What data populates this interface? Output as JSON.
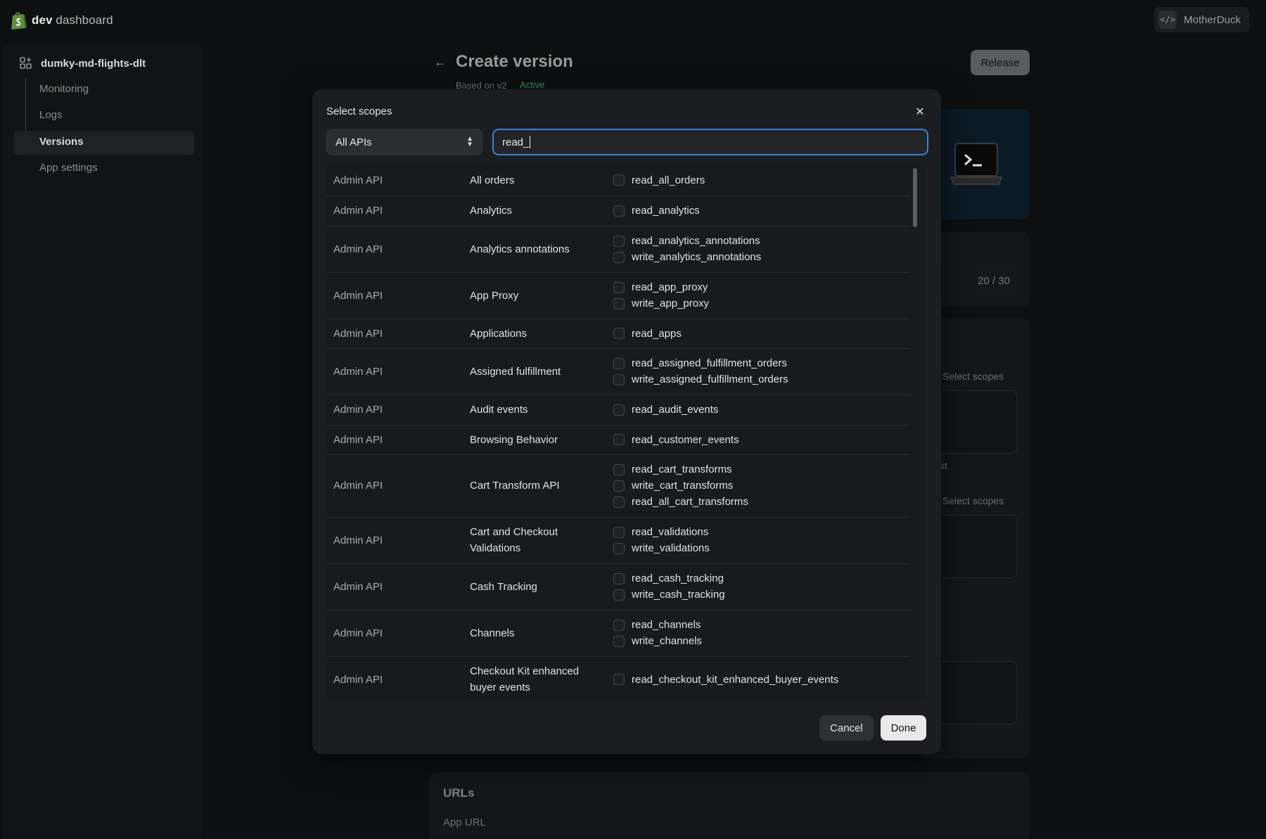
{
  "topbar": {
    "brand_bold": "dev",
    "brand_rest": " dashboard",
    "org_name": "MotherDuck",
    "org_icon": "code-icon"
  },
  "sidebar": {
    "app_name": "dumky-md-flights-dlt",
    "items": [
      {
        "label": "Monitoring"
      },
      {
        "label": "Logs"
      },
      {
        "label": "Versions"
      },
      {
        "label": "App settings"
      }
    ]
  },
  "page": {
    "title": "Create version",
    "subtitle": "Based on v2",
    "badge": "Active",
    "release_label": "Release",
    "counter": "20 / 30",
    "select_scopes_link": "Select scopes",
    "ghost_text": "st",
    "urls_title": "URLs",
    "app_url_label": "App URL"
  },
  "modal": {
    "title": "Select scopes",
    "filter_value": "All APIs",
    "search_value": "read_",
    "cancel_label": "Cancel",
    "done_label": "Done",
    "rows": [
      {
        "api": "Admin API",
        "resource": [
          "All orders"
        ],
        "scopes": [
          "read_all_orders"
        ]
      },
      {
        "api": "Admin API",
        "resource": [
          "Analytics"
        ],
        "scopes": [
          "read_analytics"
        ]
      },
      {
        "api": "Admin API",
        "resource": [
          "Analytics annotations"
        ],
        "scopes": [
          "read_analytics_annotations",
          "write_analytics_annotations"
        ]
      },
      {
        "api": "Admin API",
        "resource": [
          "App Proxy"
        ],
        "scopes": [
          "read_app_proxy",
          "write_app_proxy"
        ]
      },
      {
        "api": "Admin API",
        "resource": [
          "Applications"
        ],
        "scopes": [
          "read_apps"
        ]
      },
      {
        "api": "Admin API",
        "resource": [
          "Assigned fulfillment"
        ],
        "scopes": [
          "read_assigned_fulfillment_orders",
          "write_assigned_fulfillment_orders"
        ]
      },
      {
        "api": "Admin API",
        "resource": [
          "Audit events"
        ],
        "scopes": [
          "read_audit_events"
        ]
      },
      {
        "api": "Admin API",
        "resource": [
          "Browsing Behavior"
        ],
        "scopes": [
          "read_customer_events"
        ]
      },
      {
        "api": "Admin API",
        "resource": [
          "Cart Transform API"
        ],
        "scopes": [
          "read_cart_transforms",
          "write_cart_transforms",
          "read_all_cart_transforms"
        ]
      },
      {
        "api": "Admin API",
        "resource": [
          "Cart and Checkout",
          "Validations"
        ],
        "scopes": [
          "read_validations",
          "write_validations"
        ]
      },
      {
        "api": "Admin API",
        "resource": [
          "Cash Tracking"
        ],
        "scopes": [
          "read_cash_tracking",
          "write_cash_tracking"
        ]
      },
      {
        "api": "Admin API",
        "resource": [
          "Channels"
        ],
        "scopes": [
          "read_channels",
          "write_channels"
        ]
      },
      {
        "api": "Admin API",
        "resource": [
          "Checkout Kit enhanced",
          "buyer events"
        ],
        "scopes": [
          "read_checkout_kit_enhanced_buyer_events"
        ]
      }
    ]
  }
}
